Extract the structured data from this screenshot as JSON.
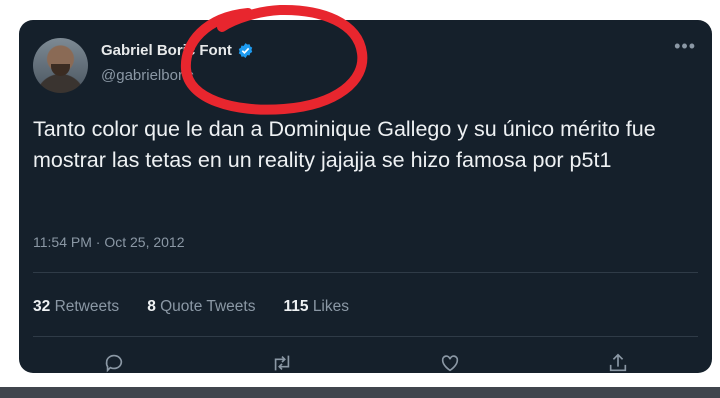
{
  "tweet": {
    "display_name": "Gabriel Boric Font",
    "handle": "@gabrielboric",
    "text": "Tanto color que le dan a Dominique Gallego y su único mérito fue mostrar las tetas en un reality jajajja se hizo famosa por p5t1",
    "timestamp": "11:54 PM · Oct 25, 2012"
  },
  "stats": {
    "retweets": {
      "count": "32",
      "label": "Retweets"
    },
    "quote_tweets": {
      "count": "8",
      "label": "Quote Tweets"
    },
    "likes": {
      "count": "115",
      "label": "Likes"
    }
  },
  "icons": [
    "verified-badge-icon",
    "more-icon",
    "reply-icon",
    "retweet-icon",
    "like-icon",
    "share-icon"
  ],
  "colors": {
    "background": "#15202b",
    "verified": "#1d9bf0",
    "annotation": "#e8262e"
  }
}
